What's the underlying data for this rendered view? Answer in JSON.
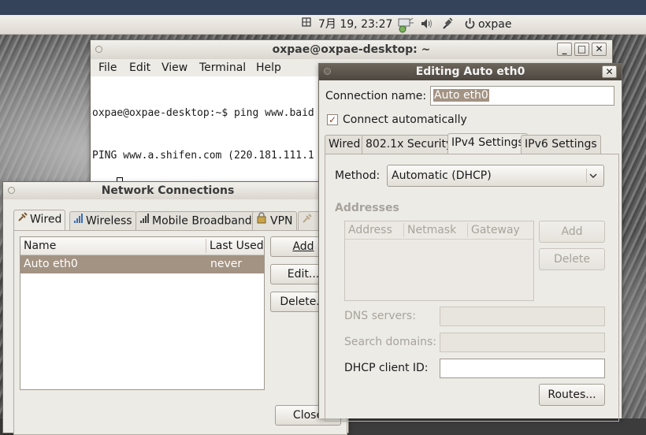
{
  "panel": {
    "ime_icon": "grid-icon",
    "datetime": "7月 19, 23:27",
    "network_icon": "network-icon",
    "volume_icon": "volume-icon",
    "bluetooth_icon": "plug-icon",
    "power_icon": "power-icon",
    "user": "oxpae"
  },
  "terminal": {
    "title": "oxpae@oxpae-desktop: ~",
    "menu": [
      "File",
      "Edit",
      "View",
      "Terminal",
      "Help"
    ],
    "lines": [
      "oxpae@oxpae-desktop:~$ ping www.baid",
      "PING www.a.shifen.com (220.181.111.1"
    ]
  },
  "network": {
    "title": "Network Connections",
    "tabs": [
      "Wired",
      "Wireless",
      "Mobile Broadband",
      "VPN"
    ],
    "columns": [
      "Name",
      "Last Used"
    ],
    "rows": [
      {
        "name": "Auto eth0",
        "last_used": "never"
      }
    ],
    "buttons": {
      "add": "Add",
      "edit": "Edit...",
      "delete": "Delete..."
    },
    "close": "Close"
  },
  "editing": {
    "title": "Editing Auto eth0",
    "connection_name_label": "Connection name:",
    "connection_name_value": "Auto eth0",
    "connect_auto_label": "Connect automatically",
    "connect_auto_checked": true,
    "tabs": [
      "Wired",
      "802.1x Security",
      "IPv4 Settings",
      "IPv6 Settings"
    ],
    "active_tab": "IPv4 Settings",
    "method_label": "Method:",
    "method_value": "Automatic (DHCP)",
    "addresses_heading": "Addresses",
    "address_columns": [
      "Address",
      "Netmask",
      "Gateway"
    ],
    "add_button": "Add",
    "delete_button": "Delete",
    "dns_label": "DNS servers:",
    "search_label": "Search domains:",
    "dhcp_label": "DHCP client ID:",
    "routes_button": "Routes..."
  },
  "colors": {
    "top_strip": "#34425a",
    "selection": "#a39383",
    "active_title": "#57504a"
  }
}
